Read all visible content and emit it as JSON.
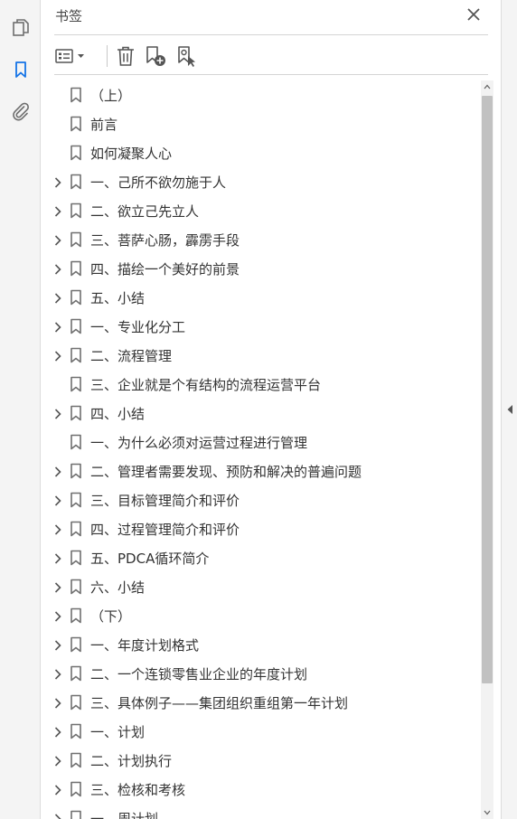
{
  "rail": {
    "tools": [
      {
        "name": "pages-icon",
        "active": false
      },
      {
        "name": "bookmark-icon",
        "active": true
      },
      {
        "name": "attachment-icon",
        "active": false
      }
    ]
  },
  "panel": {
    "title": "书签",
    "close_icon": "close-icon"
  },
  "toolbar": {
    "buttons": [
      "options-menu-icon",
      "delete-icon",
      "new-bookmark-icon",
      "bookmark-from-selection-icon"
    ]
  },
  "colors": {
    "accent": "#1473e6",
    "icon": "#6e6e6e",
    "scroll_thumb": "#c1c1c1"
  },
  "bookmarks": [
    {
      "label": "（上）",
      "expandable": false
    },
    {
      "label": "前言",
      "expandable": false
    },
    {
      "label": "如何凝聚人心",
      "expandable": false
    },
    {
      "label": "一、己所不欲勿施于人",
      "expandable": true
    },
    {
      "label": "二、欲立己先立人",
      "expandable": true
    },
    {
      "label": "三、菩萨心肠，霹雳手段",
      "expandable": true
    },
    {
      "label": "四、描绘一个美好的前景",
      "expandable": true
    },
    {
      "label": "五、小结",
      "expandable": true
    },
    {
      "label": "一、专业化分工",
      "expandable": true
    },
    {
      "label": "二、流程管理",
      "expandable": true
    },
    {
      "label": "三、企业就是个有结构的流程运营平台",
      "expandable": false
    },
    {
      "label": "四、小结",
      "expandable": true
    },
    {
      "label": "一、为什么必须对运营过程进行管理",
      "expandable": false
    },
    {
      "label": "二、管理者需要发现、预防和解决的普遍问题",
      "expandable": true
    },
    {
      "label": "三、目标管理简介和评价",
      "expandable": true
    },
    {
      "label": "四、过程管理简介和评价",
      "expandable": true
    },
    {
      "label": "五、PDCA循环简介",
      "expandable": true
    },
    {
      "label": "六、小结",
      "expandable": true
    },
    {
      "label": "（下）",
      "expandable": true
    },
    {
      "label": "一、年度计划格式",
      "expandable": true
    },
    {
      "label": "二、一个连锁零售业企业的年度计划",
      "expandable": true
    },
    {
      "label": "三、具体例子——集团组织重组第一年计划",
      "expandable": true
    },
    {
      "label": "一、计划",
      "expandable": true
    },
    {
      "label": "二、计划执行",
      "expandable": true
    },
    {
      "label": "三、检核和考核",
      "expandable": true
    },
    {
      "label": "一、周计划",
      "expandable": true
    }
  ]
}
